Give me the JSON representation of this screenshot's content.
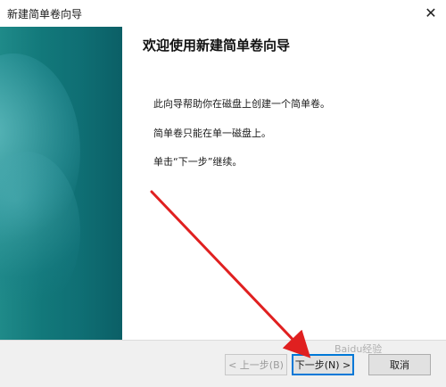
{
  "window": {
    "title": "新建简单卷向导",
    "close_symbol": "✕"
  },
  "content": {
    "heading": "欢迎使用新建简单卷向导",
    "paragraphs": [
      "此向导帮助你在磁盘上创建一个简单卷。",
      "简单卷只能在单一磁盘上。",
      "单击“下一步”继续。"
    ]
  },
  "footer": {
    "back_label": "< 上一步(B)",
    "next_label": "下一步(N) >",
    "cancel_label": "取消"
  },
  "watermark": "Baidu经验",
  "colors": {
    "banner": "#12787a",
    "arrow": "#e02020",
    "accent_border": "#0078d7"
  },
  "icons": {
    "close": "close-icon"
  }
}
